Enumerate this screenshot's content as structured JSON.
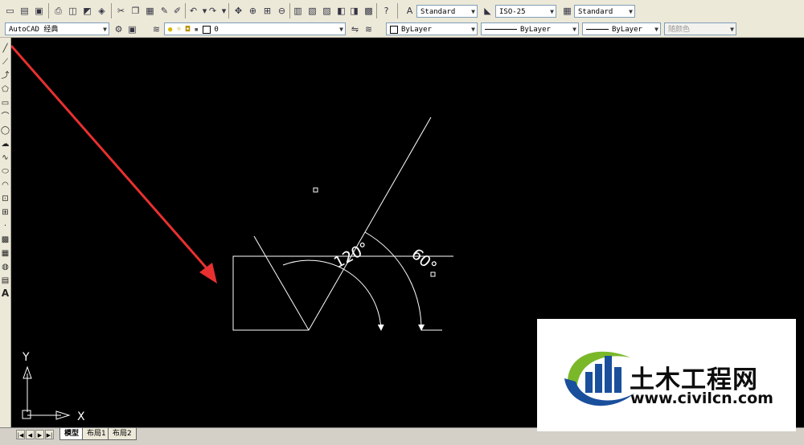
{
  "toolbar": {
    "text_style": "Standard",
    "dim_style": "ISO-25",
    "table_style": "Standard",
    "workspace": "AutoCAD 经典",
    "layer": "0",
    "color": "ByLayer",
    "linetype": "ByLayer",
    "lineweight": "ByLayer",
    "plot_style": "随颜色"
  },
  "drawing": {
    "angle_label_1": "120°",
    "angle_label_2": "60°",
    "ucs_y": "Y",
    "ucs_x": "X",
    "annotation_color": "#e83030"
  },
  "layout_tabs": [
    "模型",
    "布局1",
    "布局2"
  ],
  "left_toolbar_text_tool": "A",
  "watermark": {
    "cn": "土木工程网",
    "url": "www.civilcn.com",
    "brand_blue": "#1a4f9c",
    "brand_green": "#7ab829"
  }
}
